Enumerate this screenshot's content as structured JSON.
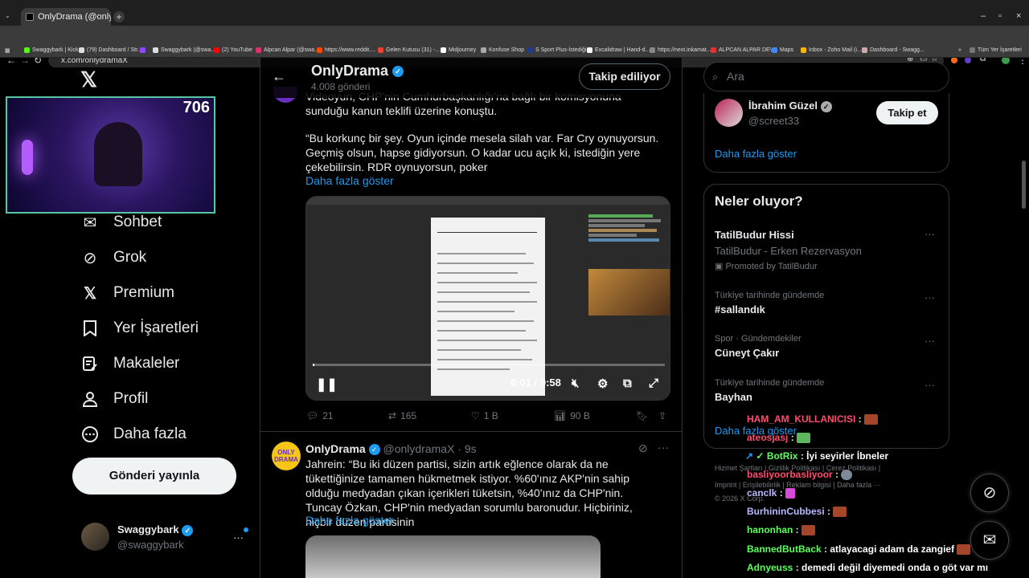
{
  "browser": {
    "tab_title": "OnlyDrama (@onlydramaX) / X",
    "tab_close": "×",
    "new_tab": "+",
    "url": "x.com/onlydramaX",
    "window_controls": [
      "–",
      "▫",
      "×"
    ],
    "bookmarks": [
      "Swaggybark | Kick",
      "(79) Dashboard / Str...",
      "Swaggybark (@swa...",
      "(2) YouTube",
      "Alpcan Alpar (@swa...",
      "https://www.reddit....",
      "Gelen Kutusu (31) -...",
      "Midjourney",
      "Konfuse Shop",
      "S Sport Plus-İstediği...",
      "Excalidraw | Hand-d...",
      "https://next.inkamat...",
      "ALPCAN ALPAR DEV...",
      "Maps",
      "Inbox - Zoho Mail (i...",
      "Dashboard - Swagg..."
    ],
    "all_bookmarks": "Tüm Yer İşaretleri"
  },
  "webcam": {
    "viewer_count": "706"
  },
  "nav": {
    "items": [
      {
        "label": "Sohbet",
        "icon": "mail-icon"
      },
      {
        "label": "Grok",
        "icon": "grok-icon"
      },
      {
        "label": "Premium",
        "icon": "x-logo-icon"
      },
      {
        "label": "Yer İşaretleri",
        "icon": "bookmark-icon"
      },
      {
        "label": "Makaleler",
        "icon": "article-icon"
      },
      {
        "label": "Profil",
        "icon": "person-icon"
      },
      {
        "label": "Daha fazla",
        "icon": "more-circle-icon"
      }
    ],
    "post_button": "Gönderi yayınla",
    "account_name": "Swaggybark",
    "account_handle": "@swaggybark"
  },
  "header": {
    "name": "OnlyDrama",
    "post_count": "4.008 gönderi",
    "follow_label": "Takip ediliyor"
  },
  "tweet1": {
    "text_top": "Videoyun, CHP'nin Cumhurbaşkanlığı'na bağlı bir komisyonuna sunduğu kanun teklifi üzerine konuştu.",
    "text_quote": "“Bu korkunç bir şey. Oyun içinde mesela silah var. Far Cry oynuyorsun. Geçmiş olsun, hapse gidiyorsun. O kadar ucu açık ki, istediğin yere çekebilirsin. RDR oynuyorsun, poker",
    "show_more": "Daha fazla göster",
    "video_time": "0:01 / 9:58",
    "video_progress": 0.002,
    "stats": {
      "replies": "21",
      "reposts": "165",
      "likes": "1 B",
      "views": "90 B"
    }
  },
  "tweet2": {
    "name": "OnlyDrama",
    "handle": "@onlydramaX",
    "time": "· 9s",
    "avatar_text": "ONLY DRAMA",
    "text": "Jahrein: “Bu iki düzen partisi, sizin artık eğlence olarak da ne tükettiğinize tamamen hükmetmek istiyor. %60'ınız AKP'nin sahip olduğu medyadan çıkan içerikleri tüketsin, %40'ınız da CHP'nin. Tuncay Özkan, CHP'nin medyadan sorumlu baronudur. Hiçbiriniz, hiçbir düzen partisinin",
    "show_more": "Daha fazla göster"
  },
  "right": {
    "search_placeholder": "Ara",
    "suggest_name": "İbrahim Güzel",
    "suggest_handle": "@screet33",
    "suggest_button": "Takip et",
    "show_more": "Daha fazla göster",
    "trends_title": "Neler oluyor?",
    "trends": [
      {
        "meta": "",
        "title": "TatilBudur Hissi",
        "sub": "TatilBudur - Erken Rezervasyon",
        "promo": "Promoted by TatilBudur"
      },
      {
        "meta": "Türkiye tarihinde gündemde",
        "title": "#sallandık"
      },
      {
        "meta": "Spor · Gündemdekiler",
        "title": "Cüneyt Çakır"
      },
      {
        "meta": "Türkiye tarihinde gündemde",
        "title": "Bayhan"
      }
    ],
    "trends_more": "Daha fazla göster",
    "footer": [
      "Hizmet Şartları",
      "Gizlilik Politikası",
      "Çerez Politikası",
      "Imprint",
      "Erişilebilirlik",
      "Reklam bilgisi",
      "Daha fazla ···",
      "© 2026 X Corp."
    ]
  },
  "chat": [
    {
      "user": "HAM_AM_KULLANICISI",
      "msg": "",
      "color": "#ff4d6d"
    },
    {
      "user": "ateosjasj",
      "msg": "",
      "color": "#ff4d6d"
    },
    {
      "user": "BotRix",
      "msg": "İyi seyirler İbneler",
      "color": "#5cff5c"
    },
    {
      "user": "basliyoorbasliyoor",
      "msg": "",
      "color": "#ff4d6d"
    },
    {
      "user": "canclk",
      "msg": "",
      "color": "#b8b8ff"
    },
    {
      "user": "BurhininCubbesi",
      "msg": "",
      "color": "#b8b8ff"
    },
    {
      "user": "hanonhan",
      "msg": "",
      "color": "#5cff5c"
    },
    {
      "user": "BannedButBack",
      "msg": "atlayacagi adam da zangief",
      "color": "#5cff5c"
    },
    {
      "user": "Adnyeuss",
      "msg": "demedi değil diyemedi onda o göt var mı",
      "color": "#5cff5c"
    }
  ],
  "colors": {
    "accent": "#1d9bf0",
    "background": "#000000",
    "border": "#2f3336"
  }
}
